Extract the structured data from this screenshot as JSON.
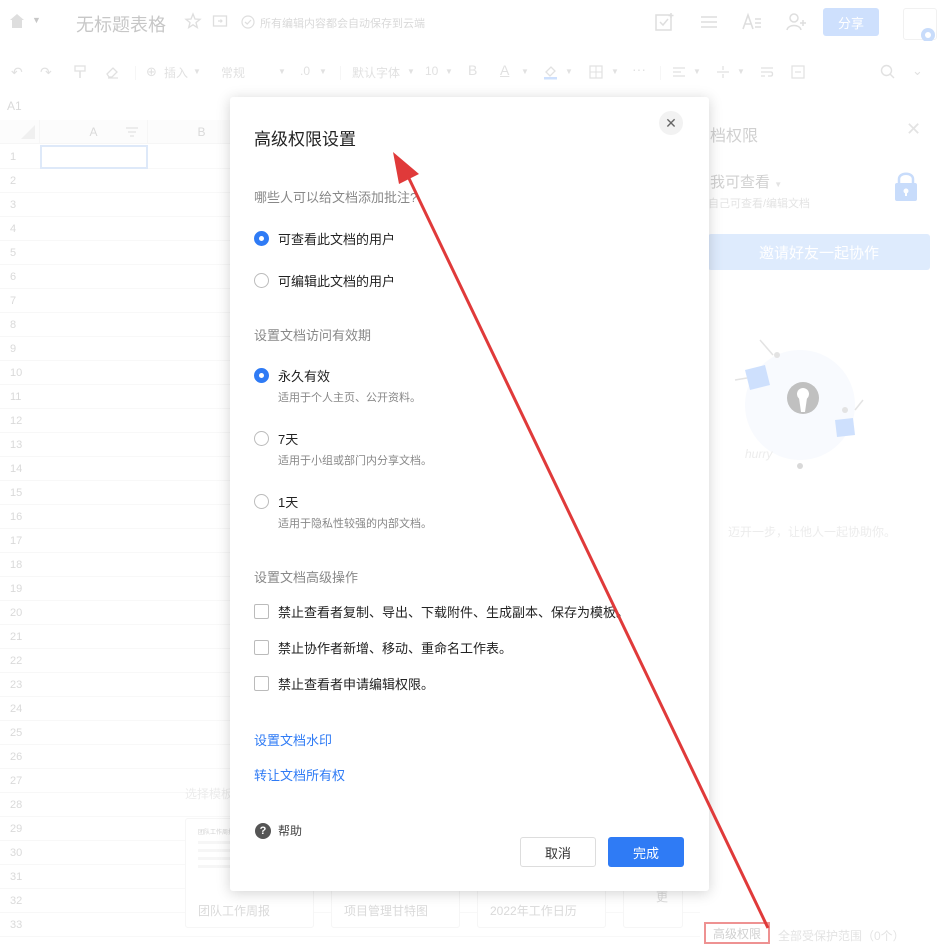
{
  "header": {
    "doc_title": "无标题表格",
    "save_status": "所有编辑内容都会自动保存到云端",
    "share_label": "分享"
  },
  "toolbar": {
    "insert_label": "插入",
    "format_label": "常规",
    "decimal_label": ".0",
    "font_label": "默认字体",
    "size_label": "10",
    "bold_label": "B",
    "text_color_label": "A"
  },
  "sheet": {
    "cell_ref": "A1",
    "columns": [
      "A",
      "B"
    ],
    "rows": [
      "1",
      "2",
      "3",
      "4",
      "5",
      "6",
      "7",
      "8",
      "9",
      "10",
      "11",
      "12",
      "13",
      "14",
      "15",
      "16",
      "17",
      "18",
      "19",
      "20",
      "21",
      "22",
      "23",
      "24",
      "25",
      "26",
      "27",
      "28",
      "29",
      "30",
      "31",
      "32",
      "33"
    ],
    "template_area_label": "选择模板",
    "templates": [
      "团队工作周报",
      "项目管理甘特图",
      "2022年工作日历",
      "更"
    ]
  },
  "side_panel": {
    "title": "档权限",
    "permission": "我可查看",
    "permission_sub": "自己可查看/编辑文档",
    "invite_label": "邀请好友一起协作",
    "hint": "迈开一步，让他人一起协助你。",
    "advanced_link": "高级权限",
    "protect_range": "全部受保护范围（0个）"
  },
  "modal": {
    "title": "高级权限设置",
    "comment_section": "哪些人可以给文档添加批注?",
    "comment_options": [
      {
        "label": "可查看此文档的用户",
        "checked": true
      },
      {
        "label": "可编辑此文档的用户",
        "checked": false
      }
    ],
    "validity_section": "设置文档访问有效期",
    "validity_options": [
      {
        "label": "永久有效",
        "desc": "适用于个人主页、公开资料。",
        "checked": true
      },
      {
        "label": "7天",
        "desc": "适用于小组或部门内分享文档。",
        "checked": false
      },
      {
        "label": "1天",
        "desc": "适用于隐私性较强的内部文档。",
        "checked": false
      }
    ],
    "advanced_section": "设置文档高级操作",
    "advanced_options": [
      {
        "label": "禁止查看者复制、导出、下载附件、生成副本、保存为模板。",
        "checked": false
      },
      {
        "label": "禁止协作者新增、移动、重命名工作表。",
        "checked": false
      },
      {
        "label": "禁止查看者申请编辑权限。",
        "checked": false
      }
    ],
    "watermark_link": "设置文档水印",
    "transfer_link": "转让文档所有权",
    "help_label": "帮助",
    "cancel_label": "取消",
    "done_label": "完成"
  },
  "colors": {
    "accent": "#2f7bf5",
    "annotation": "#e03a3a"
  }
}
